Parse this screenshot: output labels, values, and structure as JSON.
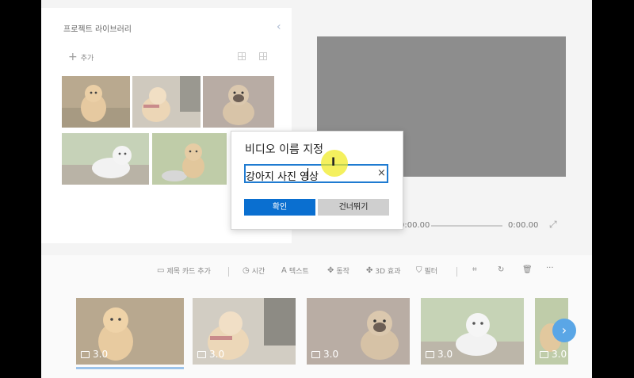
{
  "library": {
    "title": "프로젝트 라이브러리",
    "add_label": "추가"
  },
  "preview": {
    "time_start": "0:00.00",
    "time_end": "0:00.00"
  },
  "toolbar": {
    "items": [
      {
        "label": "제목 카드 추가",
        "icon": "title-card-icon"
      },
      {
        "label": "시간",
        "icon": "clock-icon"
      },
      {
        "label": "텍스트",
        "icon": "text-icon"
      },
      {
        "label": "동작",
        "icon": "motion-icon"
      },
      {
        "label": "3D 효과",
        "icon": "3d-effects-icon"
      },
      {
        "label": "필터",
        "icon": "filter-icon"
      }
    ],
    "more": "···"
  },
  "storyboard": {
    "cards": [
      {
        "duration": "3.0"
      },
      {
        "duration": "3.0"
      },
      {
        "duration": "3.0"
      },
      {
        "duration": "3.0"
      },
      {
        "duration": "3.0"
      }
    ]
  },
  "dialog": {
    "title": "비디오 이름 지정",
    "input_value": "강아지 사진 영상",
    "clear": "×",
    "confirm_label": "확인",
    "skip_label": "건너뛰기"
  },
  "colors": {
    "accent": "#0a6fd0",
    "input_border": "#1f7bd1",
    "next_button": "#5aa6e6",
    "preview": "#8d8d8d"
  }
}
